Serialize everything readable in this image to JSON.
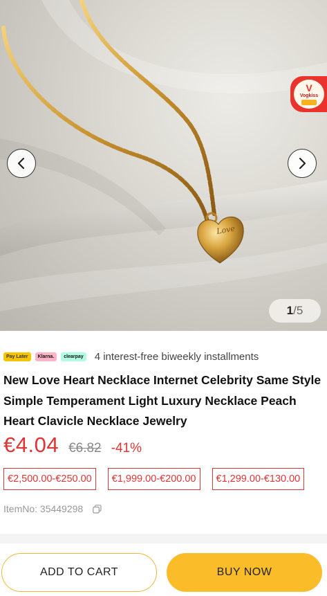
{
  "gallery": {
    "image_alt": "Gold heart pendant necklace with \"Love\" engraving on silk fabric",
    "counter_current": "1",
    "counter_total": "/5",
    "prev_icon": "chevron-left-icon",
    "next_icon": "chevron-right-icon",
    "badge_text": "Vogkiss"
  },
  "installments": {
    "logos": [
      "Pay Later",
      "Klarna.",
      "clearpay"
    ],
    "text": "4 interest-free biweekly installments"
  },
  "product": {
    "title": "New Love Heart Necklace Internet Celebrity Same Style Simple Temperament Light Luxury Necklace Peach Heart Clavicle Necklace Jewelry",
    "price": "€4.04",
    "original_price": "€6.82",
    "discount": "-41%",
    "coupons": [
      "€2,500.00-€250.00",
      "€1,999.00-€200.00",
      "€1,299.00-€130.00"
    ],
    "item_no": "ItemNo: 35449298"
  },
  "actions": {
    "add_to_cart": "ADD TO CART",
    "buy_now": "BUY NOW"
  },
  "colors": {
    "accent_red": "#e03535",
    "button_yellow": "#fbbc2a",
    "button_border": "#f2b53a"
  }
}
